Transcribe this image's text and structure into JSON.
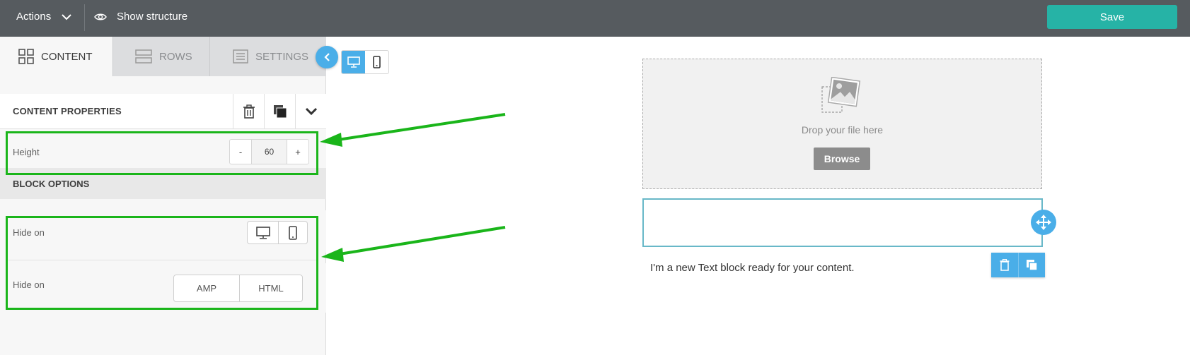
{
  "topbar": {
    "actions_label": "Actions",
    "show_structure_label": "Show structure",
    "save_label": "Save"
  },
  "sidebar": {
    "tabs": [
      {
        "label": "CONTENT",
        "icon": "grid-icon",
        "active": true
      },
      {
        "label": "ROWS",
        "icon": "rows-icon",
        "active": false
      },
      {
        "label": "SETTINGS",
        "icon": "settings-icon",
        "active": false
      }
    ],
    "content_properties": {
      "title": "CONTENT PROPERTIES",
      "height_label": "Height",
      "height_value": "60",
      "minus_label": "-",
      "plus_label": "+"
    },
    "block_options": {
      "title": "BLOCK OPTIONS",
      "hide_on_device_label": "Hide on",
      "hide_on_format_label": "Hide on",
      "format_options": [
        "AMP",
        "HTML"
      ]
    }
  },
  "canvas": {
    "drop_text": "Drop your file here",
    "browse_label": "Browse",
    "text_block": "I'm a new Text block ready for your content."
  },
  "colors": {
    "topbar": "#565b5f",
    "save": "#26b3a6",
    "accent": "#4aaee8",
    "highlight": "#1ab51a"
  }
}
